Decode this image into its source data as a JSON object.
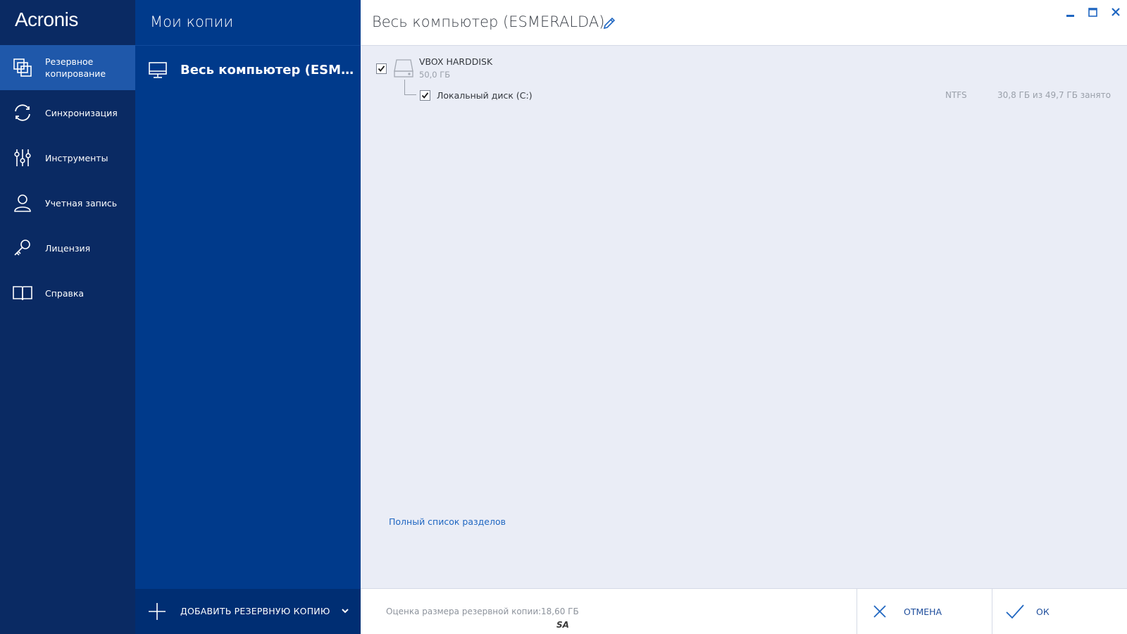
{
  "app": {
    "logo_text": "Acronis"
  },
  "colors": {
    "nav_bg": "#0a2a63",
    "nav_active": "#1f58aa",
    "mid_bg": "#003a8b",
    "content_bg": "#eaedf6",
    "accent": "#1f66c1"
  },
  "nav": {
    "items": [
      {
        "label": "Резервное\nкопирование",
        "icon": "backup-icon",
        "active": true
      },
      {
        "label": "Синхронизация",
        "icon": "sync-icon",
        "active": false
      },
      {
        "label": "Инструменты",
        "icon": "tools-icon",
        "active": false
      },
      {
        "label": "Учетная запись",
        "icon": "account-icon",
        "active": false
      },
      {
        "label": "Лицензия",
        "icon": "key-icon",
        "active": false
      },
      {
        "label": "Справка",
        "icon": "book-icon",
        "active": false
      }
    ]
  },
  "backups": {
    "title": "Мои копии",
    "items": [
      {
        "label": "Весь компьютер (ESMERALDA)",
        "icon": "monitor-icon"
      }
    ],
    "add_label": "ДОБАВИТЬ РЕЗЕРВНУЮ КОПИЮ"
  },
  "detail": {
    "title": "Весь компьютер (ESMERALDA)",
    "disk": {
      "name": "VBOX HARDDISK",
      "size": "50,0 ГБ",
      "checked": true
    },
    "partition": {
      "name": "Локальный диск (C:)",
      "fs": "NTFS",
      "usage": "30,8 ГБ из 49,7 ГБ занято",
      "checked": true
    },
    "full_list_link": "Полный список разделов"
  },
  "footer": {
    "estimate_label": "Оценка размера резервной копии:",
    "estimate_value": "18,60 ГБ",
    "sa_mark": "SA",
    "cancel_label": "ОТМЕНА",
    "ok_label": "ОК"
  }
}
